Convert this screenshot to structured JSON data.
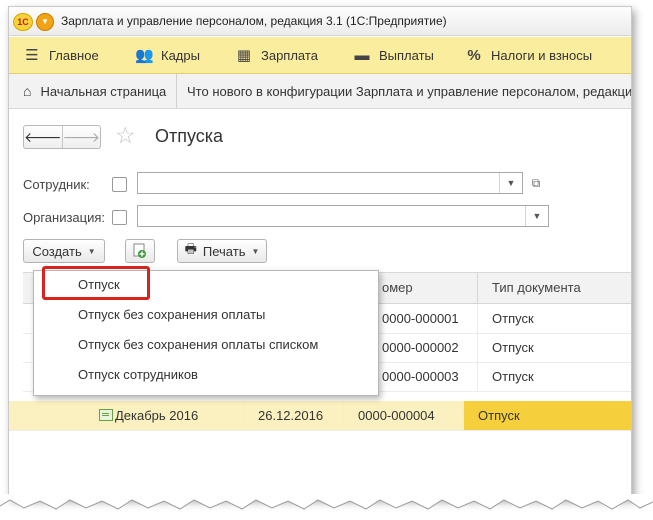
{
  "window": {
    "title": "Зарплата и управление персоналом, редакция 3.1  (1С:Предприятие)",
    "logo_text": "1С"
  },
  "sections": [
    {
      "label": "Главное",
      "icon": "hamburger-icon"
    },
    {
      "label": "Кадры",
      "icon": "people-icon"
    },
    {
      "label": "Зарплата",
      "icon": "calculator-icon"
    },
    {
      "label": "Выплаты",
      "icon": "wallet-icon"
    },
    {
      "label": "Налоги и взносы",
      "icon": "percent-icon"
    }
  ],
  "tabs": {
    "home": "Начальная страница",
    "whatsnew": "Что нового в конфигурации Зарплата и управление персоналом, редакция"
  },
  "form": {
    "title": "Отпуска",
    "employee_label": "Сотрудник:",
    "employee_value": "",
    "organization_label": "Организация:",
    "organization_value": ""
  },
  "toolbar": {
    "create_label": "Создать",
    "print_label": "Печать"
  },
  "table": {
    "headers": [
      "Номер",
      "Тип документа"
    ],
    "header_number_visible": "омер",
    "rows": [
      {
        "month": "",
        "date": "",
        "number": "0000-000001",
        "type": "Отпуск",
        "selected": false
      },
      {
        "month": "",
        "date": "",
        "number": "0000-000002",
        "type": "Отпуск",
        "selected": false
      },
      {
        "month": "",
        "date": "",
        "number": "0000-000003",
        "type": "Отпуск",
        "selected": false
      },
      {
        "month": "Декабрь 2016",
        "date": "26.12.2016",
        "number": "0000-000004",
        "type": "Отпуск",
        "selected": true
      }
    ]
  },
  "popup": {
    "items": [
      "Отпуск",
      "Отпуск без сохранения оплаты",
      "Отпуск без сохранения оплаты списком",
      "Отпуск сотрудников"
    ],
    "highlighted_index": 0
  },
  "colors": {
    "section_bar": "#fbed9e",
    "selected_row": "#fbf1c0",
    "selected_cell": "#f6d03c",
    "highlight_frame": "#d9231f"
  }
}
